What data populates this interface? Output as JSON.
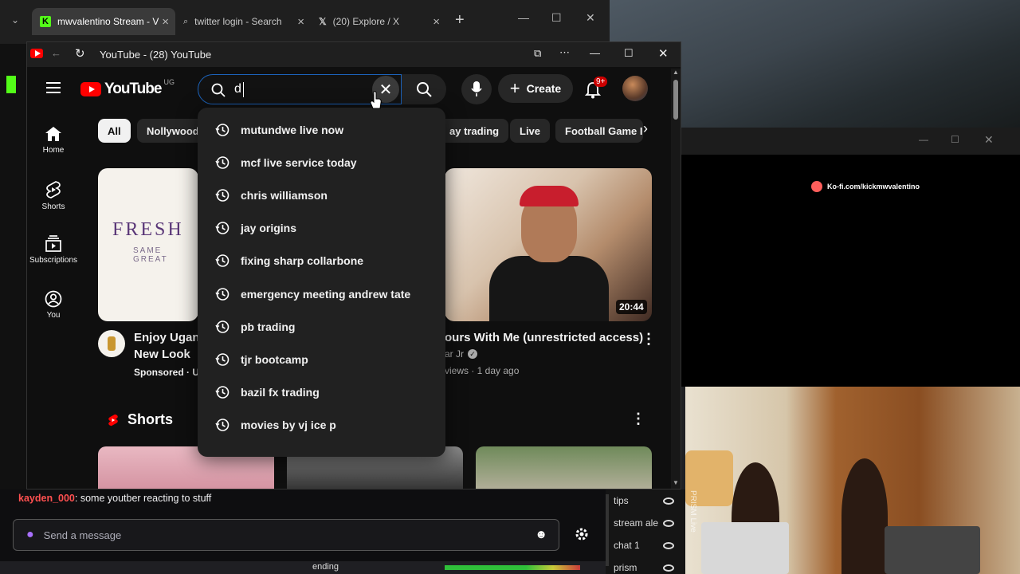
{
  "outer_browser": {
    "tabs": [
      {
        "label": "mwvalentino Stream - V",
        "active": true
      },
      {
        "label": "twitter login - Search"
      },
      {
        "label": "(20) Explore / X"
      }
    ]
  },
  "youtube_window": {
    "title": "YouTube - (28) YouTube",
    "region": "UG",
    "logo_text": "YouTube",
    "search": {
      "value": "d"
    },
    "create_label": "Create",
    "notification_badge": "9+"
  },
  "sidebar": {
    "items": [
      {
        "label": "Home"
      },
      {
        "label": "Shorts"
      },
      {
        "label": "Subscriptions"
      },
      {
        "label": "You"
      }
    ]
  },
  "chips": [
    "All",
    "Nollywood",
    "ay trading",
    "Live",
    "Football Game I"
  ],
  "suggestions": [
    "mutundwe live now",
    "mcf live service today",
    "chris williamson",
    "jay origins",
    "fixing sharp collarbone",
    "emergency meeting andrew tate",
    "pb trading",
    "tjr bootcamp",
    "bazil fx trading",
    "movies by vj ice p"
  ],
  "videos": [
    {
      "thumb_text_1": "FRESH",
      "thumb_text_2": "SAME GREAT",
      "title_line1": "Enjoy Uganc",
      "title_line2": "New Look",
      "sponsored": "Sponsored · U"
    },
    {
      "duration": "20:44",
      "title": "ours With Me (unrestricted access)",
      "channel": "ar Jr",
      "stats": "views · 1 day ago"
    }
  ],
  "shorts_heading": "Shorts",
  "chat": {
    "username": "kayden_000",
    "message": ": some youtber reacting to stuff",
    "placeholder": "Send a message"
  },
  "overlay": {
    "kofi": "Ko-fi.com/kickmwvalentino",
    "prism_vertical": "PRISM Live"
  },
  "obs_sources": [
    "tips",
    "stream ale",
    "chat 1",
    "prism"
  ],
  "scene_label": "ending",
  "colors": {
    "youtube_red": "#ff0000",
    "kick_green": "#53fc18",
    "search_focus": "#1c62b9",
    "chat_user": "#ff5050"
  }
}
